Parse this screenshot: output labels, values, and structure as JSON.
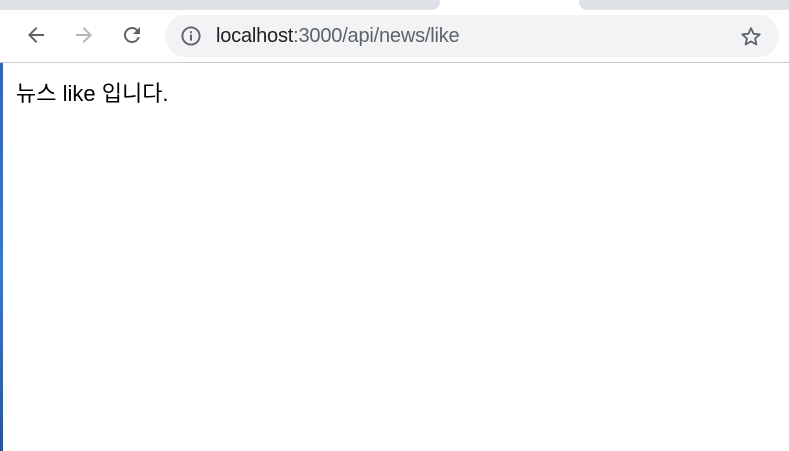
{
  "browser": {
    "nav": {
      "back_icon": "arrow-left-icon",
      "forward_icon": "arrow-right-icon",
      "reload_icon": "reload-icon"
    },
    "address_bar": {
      "info_icon": "info-icon",
      "host": "localhost",
      "path": ":3000/api/news/like",
      "bookmark_icon": "star-icon"
    }
  },
  "page": {
    "body_text": "뉴스 like 입니다."
  },
  "colors": {
    "tab_strip": "#dee1e6",
    "omnibox_bg": "#f1f3f4",
    "icon_active": "#5f6368",
    "icon_disabled": "#b4b6b9",
    "text": "#000000"
  }
}
